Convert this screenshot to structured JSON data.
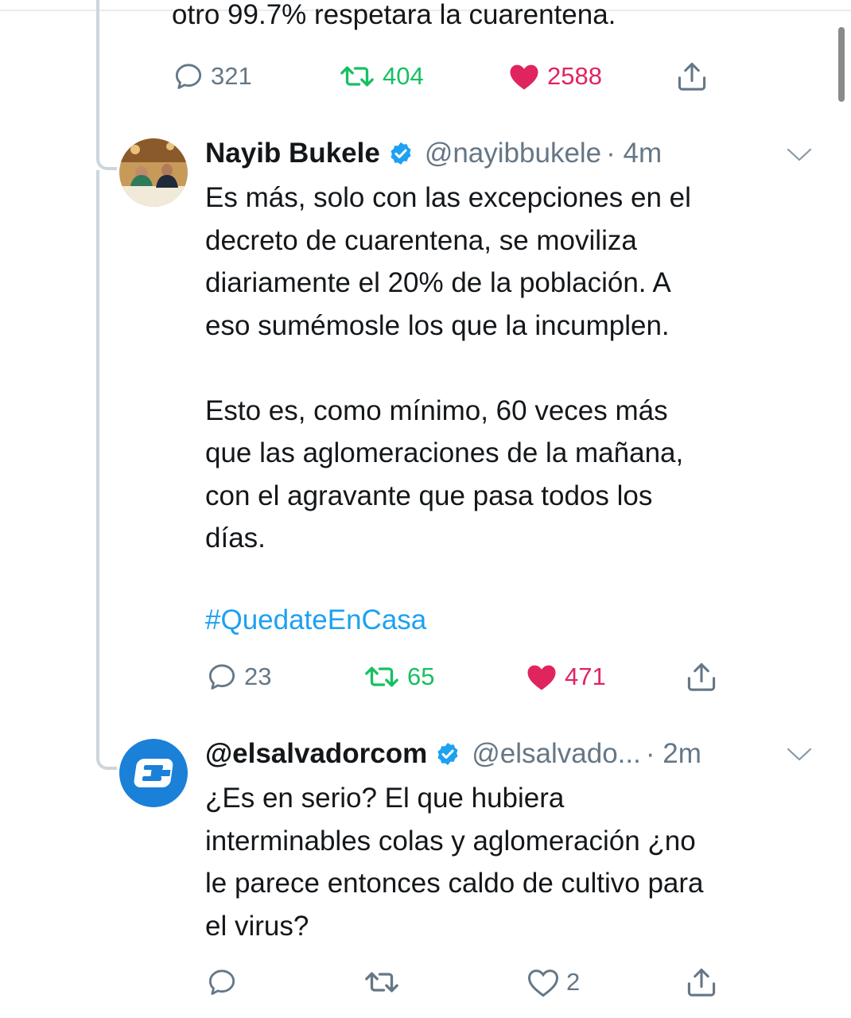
{
  "prev_tweet": {
    "text_tail": "otro 99.7% respetara la cuarentena.",
    "actions": {
      "replies": "321",
      "retweets": "404",
      "likes": "2588"
    }
  },
  "tweet1": {
    "name": "Nayib Bukele",
    "handle": "@nayibbukele",
    "time": "· 4m",
    "body": "Es más, solo con las excepciones en el\ndecreto de cuarentena, se moviliza\ndiariamente el 20% de la población. A\neso sumémosle los que la incumplen.\n\nEsto es, como mínimo, 60 veces más\nque las aglomeraciones de la mañana,\ncon el agravante que pasa todos los\ndías.",
    "hashtag": "#QuedateEnCasa",
    "actions": {
      "replies": "23",
      "retweets": "65",
      "likes": "471"
    }
  },
  "tweet2": {
    "name": "@elsalvadorcom",
    "handle": "@elsalvado...",
    "time": " · 2m",
    "body": "¿Es en serio? El que hubiera\ninterminables colas y aglomeración ¿no\nle parece entonces caldo de cultivo para\nel virus?",
    "actions": {
      "likes": "2"
    }
  },
  "colors": {
    "link": "#1da1f2",
    "retweet": "#17bf63",
    "like": "#e0245e",
    "muted": "#657786"
  },
  "icons": [
    "reply-icon",
    "retweet-icon",
    "like-icon",
    "share-icon",
    "verified-badge-icon",
    "chevron-down-icon"
  ]
}
